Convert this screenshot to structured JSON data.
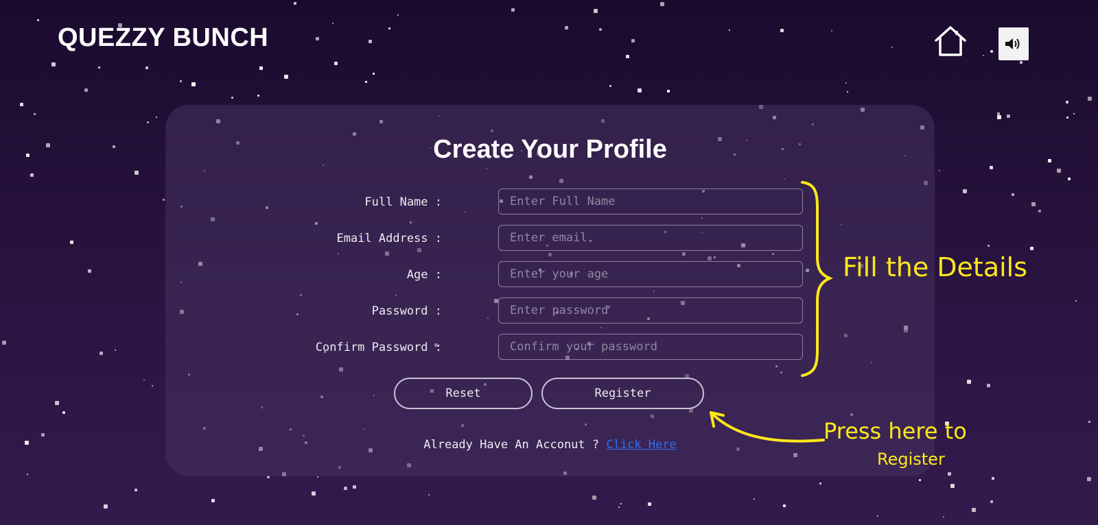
{
  "header": {
    "brand": "QUEZZY BUNCH",
    "home_icon": "home-icon",
    "sound_icon": "speaker-icon"
  },
  "form": {
    "title": "Create Your Profile",
    "fields": [
      {
        "label": "Full Name :",
        "placeholder": "Enter Full Name",
        "type": "text"
      },
      {
        "label": "Email Address :",
        "placeholder": "Enter email",
        "type": "email"
      },
      {
        "label": "Age :",
        "placeholder": "Enter your age",
        "type": "number"
      },
      {
        "label": "Password :",
        "placeholder": "Enter password",
        "type": "password"
      },
      {
        "label": "Confirm Password :",
        "placeholder": "Confirm your password",
        "type": "password"
      }
    ],
    "reset_label": "Reset",
    "register_label": "Register",
    "login_prompt": "Already Have An Acconut ?",
    "login_link": "Click Here"
  },
  "annotations": {
    "fill_details": "Fill the Details",
    "press_here": "Press here to",
    "register": "Register",
    "color": "#ffe81a"
  },
  "colors": {
    "background": "#1a0b2e",
    "card": "#46325f",
    "link": "#2f6ff0"
  }
}
